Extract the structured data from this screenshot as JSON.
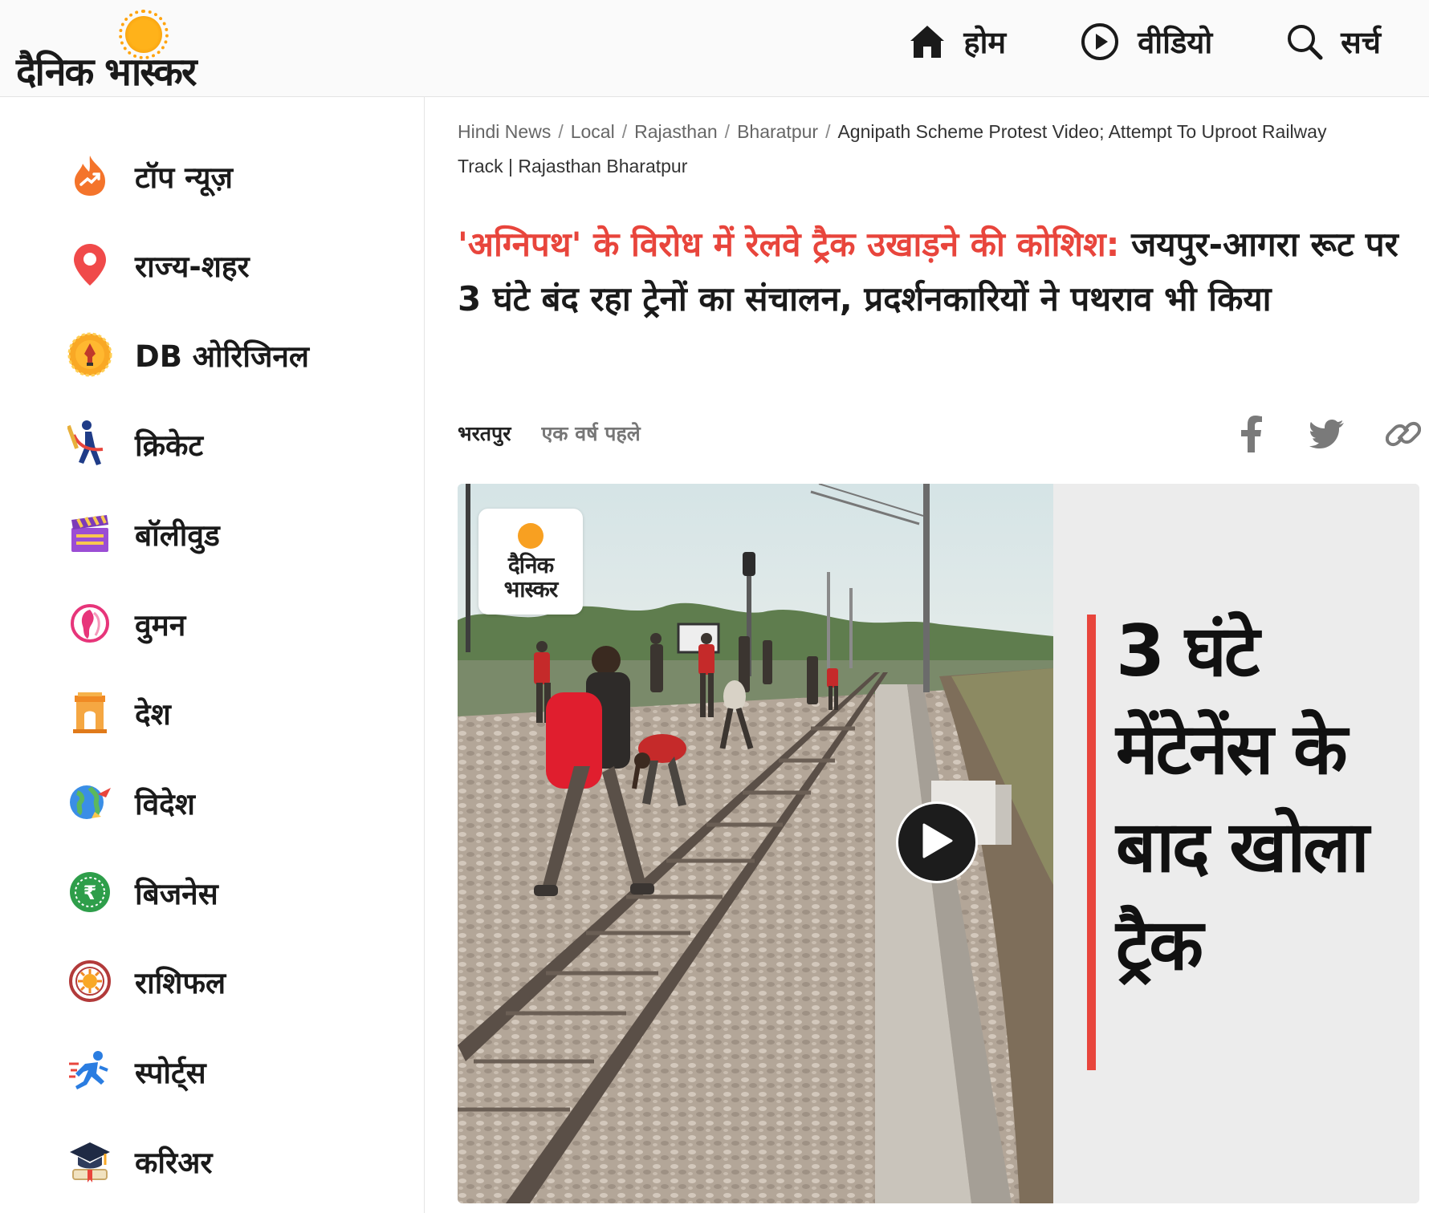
{
  "header": {
    "logo_text": "दैनिक भास्कर",
    "nav": [
      {
        "label": "होम",
        "icon": "home-icon"
      },
      {
        "label": "वीडियो",
        "icon": "play-circle-icon"
      },
      {
        "label": "सर्च",
        "icon": "search-icon"
      }
    ]
  },
  "sidebar": {
    "items": [
      {
        "label": "टॉप न्यूज़",
        "icon": "flame-trend-icon"
      },
      {
        "label": "राज्य-शहर",
        "icon": "location-pin-icon"
      },
      {
        "label": "DB ओरिजिनल",
        "icon": "db-original-pen-icon"
      },
      {
        "label": "क्रिकेट",
        "icon": "cricket-batsman-icon"
      },
      {
        "label": "बॉलीवुड",
        "icon": "clapperboard-icon"
      },
      {
        "label": "वुमन",
        "icon": "woman-silhouette-icon"
      },
      {
        "label": "देश",
        "icon": "india-gate-icon"
      },
      {
        "label": "विदेश",
        "icon": "globe-plane-icon"
      },
      {
        "label": "बिजनेस",
        "icon": "rupee-coin-icon"
      },
      {
        "label": "राशिफल",
        "icon": "zodiac-wheel-icon"
      },
      {
        "label": "स्पोर्ट्स",
        "icon": "runner-icon"
      },
      {
        "label": "करिअर",
        "icon": "graduation-cap-icon"
      }
    ]
  },
  "breadcrumb": {
    "items": [
      "Hindi News",
      "Local",
      "Rajasthan",
      "Bharatpur"
    ],
    "separator": "/",
    "current": "Agnipath Scheme Protest Video; Attempt To Uproot Railway Track | Rajasthan Bharatpur"
  },
  "article": {
    "headline_accent": "'अग्निपथ' के विरोध में रेलवे ट्रैक उखाड़ने की कोशिश:",
    "headline_rest": "जयपुर-आगरा रूट पर 3 घंटे बंद रहा ट्रेनों का संचालन, प्रदर्शनकारियों ने पथराव भी किया",
    "location": "भरतपुर",
    "published": "एक वर्ष पहले",
    "share_icons": [
      "facebook-icon",
      "twitter-icon",
      "link-icon"
    ]
  },
  "video": {
    "watermark_text": "दैनिक भास्कर",
    "caption": "3 घंटे मेंटेनेंस के बाद खोला ट्रैक",
    "play_icon": "play-icon"
  },
  "colors": {
    "accent_red": "#e8453c",
    "logo_sun": "#f8a021",
    "text_dark": "#1a1a1a"
  }
}
